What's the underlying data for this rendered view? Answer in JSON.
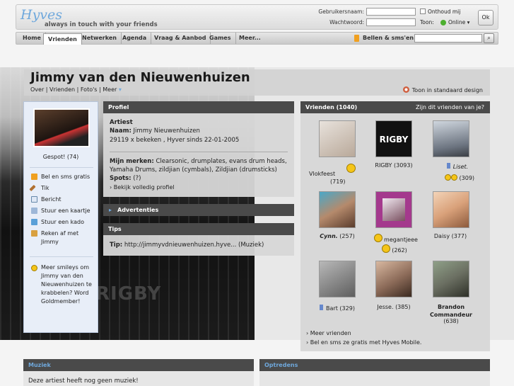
{
  "header": {
    "logo": "Hyves",
    "tagline": "always in touch with your friends",
    "username_label": "Gebruikersnaam:",
    "password_label": "Wachtwoord:",
    "remember_label": "Onthoud mij",
    "show_label": "Toon:",
    "status_value": "Online",
    "ok_label": "Ok"
  },
  "nav": {
    "items": [
      "Home",
      "Vrienden",
      "Netwerken",
      "Agenda",
      "Vraag & Aanbod",
      "Games",
      "Meer..."
    ],
    "bellen": "Bellen & sms'en"
  },
  "profile": {
    "name": "Jimmy van den Nieuwenhuizen",
    "sublinks": "Over | Vrienden | Foto's | Meer",
    "toon_label": "Toon in standaard design"
  },
  "sidebar": {
    "gespot": "Gespot! (74)",
    "actions": [
      "Bel en sms gratis",
      "Tik",
      "Bericht",
      "Stuur een kaartje",
      "Stuur een kado",
      "Reken af met Jimmy"
    ],
    "smiley_text": "Meer smileys om Jimmy van den Nieuwenhuizen te krabbelen? Word Goldmember!"
  },
  "profiel": {
    "title": "Profiel",
    "artist_label": "Artiest",
    "naam_label": "Naam:",
    "naam_value": "Jimmy Nieuwenhuizen",
    "views": "29119 x bekeken , Hyver sinds 22-01-2005",
    "merken_label": "Mijn merken:",
    "merken_value_1": "Clearsonic, drumplates, evans drum heads,",
    "merken_value_2": "Yamaha Drums, zildjian (cymbals), Zildjian (drumsticks)",
    "spots_label": "Spots:",
    "spots_value": "(?)",
    "full_profile": "Bekijk volledig profiel"
  },
  "advertenties": {
    "title": "Advertenties"
  },
  "tips": {
    "title": "Tips",
    "tip_label": "Tip:",
    "tip_value": "http://jimmyvdnieuwenhuizen.hyve... (Muziek)"
  },
  "vrienden": {
    "title": "Vrienden (1040)",
    "question": "Zijn dit vrienden van je?",
    "friends": [
      {
        "name": "Vlokfeest",
        "count": "(719)",
        "color": "#cfc7c0"
      },
      {
        "name": "RIGBY",
        "count": "(3093)",
        "color": "#111111"
      },
      {
        "name": "Liset.",
        "count": "(309)",
        "color": "#8a8f95"
      },
      {
        "name": "Cynn.",
        "count": "(257)",
        "color": "#b58a6c"
      },
      {
        "name": "megantjeee",
        "count": "(262)",
        "color": "#a4398d"
      },
      {
        "name": "Daisy",
        "count": "(377)",
        "color": "#d9a17a"
      },
      {
        "name": "Bart",
        "count": "(329)",
        "color": "#7d7d7d"
      },
      {
        "name": "Jesse.",
        "count": "(385)",
        "color": "#8b6a58"
      },
      {
        "name": "Brandon Commandeur",
        "count": "(638)",
        "color": "#6b6f62"
      }
    ],
    "rigby_logo": "RIGBY",
    "more": "Meer vrienden",
    "mobile": "Bel en sms ze gratis met Hyves Mobile."
  },
  "muziek": {
    "title": "Muziek",
    "empty": "Deze artiest heeft nog geen muziek!"
  },
  "optredens": {
    "title": "Optredens"
  },
  "background": {
    "text": "RIGBY"
  }
}
